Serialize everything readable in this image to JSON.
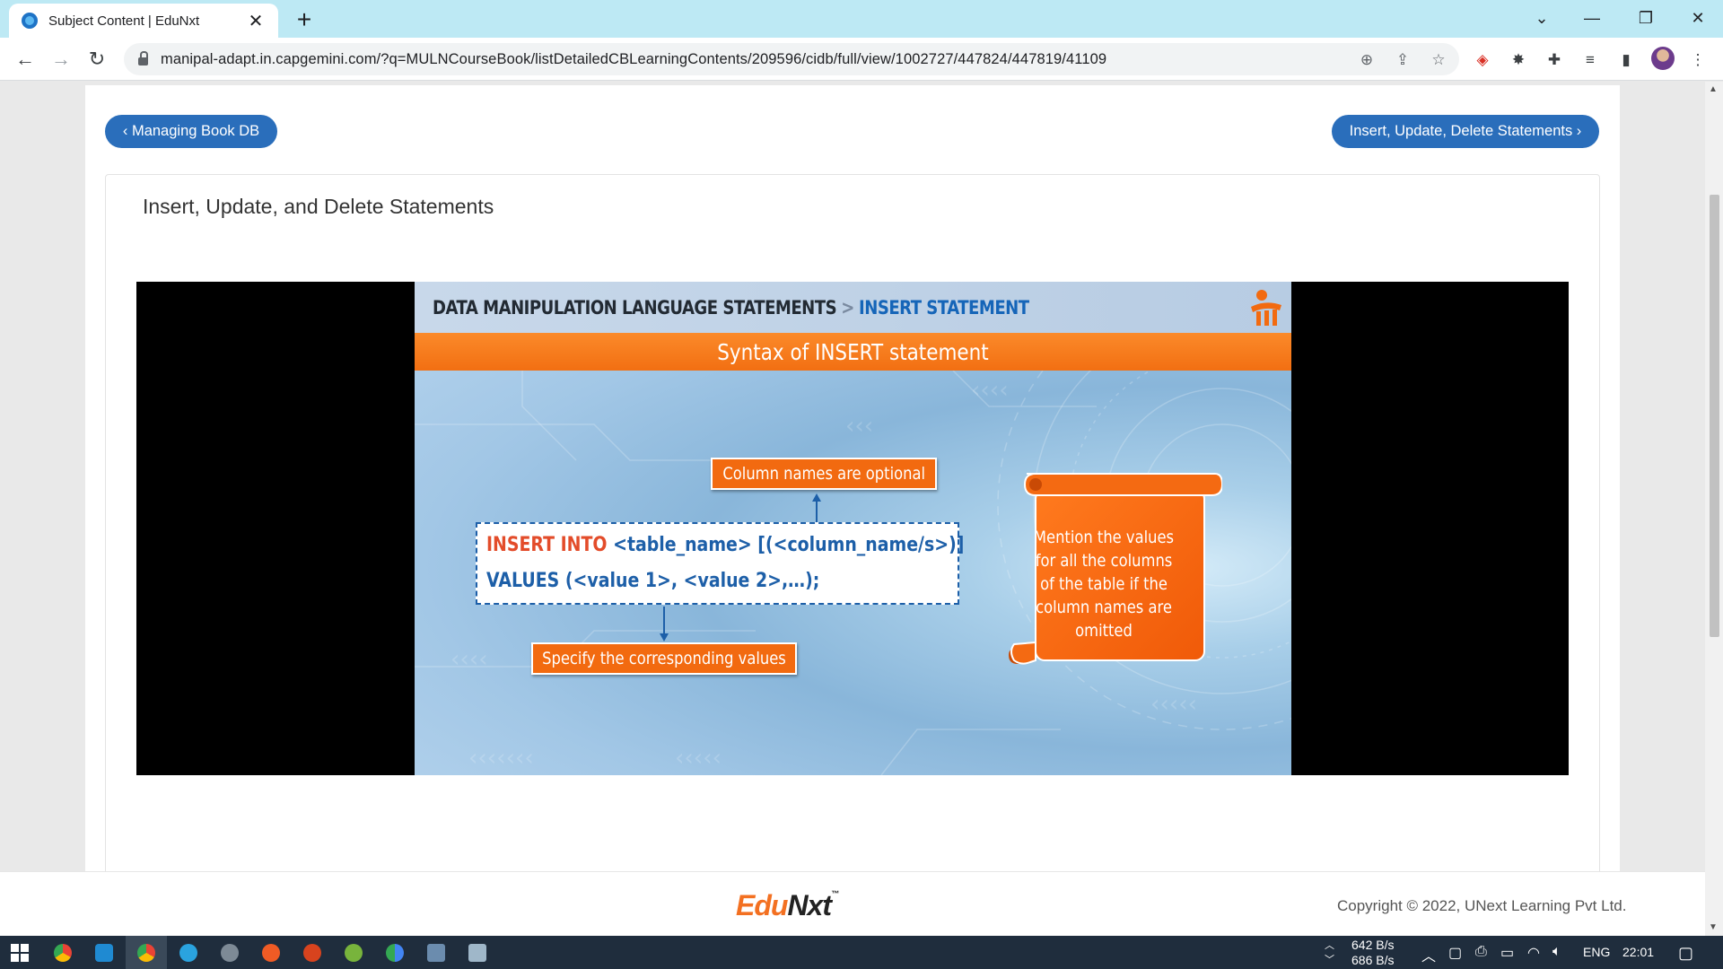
{
  "browser": {
    "tab_title": "Subject Content | EduNxt",
    "url": "manipal-adapt.in.capgemini.com/?q=MULNCourseBook/listDetailedCBLearningContents/209596/cidb/full/view/1002727/447824/447819/41109"
  },
  "nav": {
    "prev_label": "‹ Managing Book DB",
    "next_label": "Insert, Update, Delete Statements ›"
  },
  "lesson": {
    "title": "Insert, Update, and Delete Statements"
  },
  "slide": {
    "header_main": "DATA MANIPULATION LANGUAGE STATEMENTS",
    "header_sep": ">",
    "header_sub": "INSERT STATEMENT",
    "banner": "Syntax of INSERT statement",
    "callout_top": "Column names are optional",
    "syntax_kw1": "INSERT INTO",
    "syntax_rest1": " <table_name> [(<column_name/s>)]",
    "syntax_line2": "VALUES (<value 1>, <value 2>,…);",
    "callout_bottom": "Specify the corresponding values",
    "scroll_text": "Mention the values for all the columns of the table if the column names are omitted"
  },
  "footer": {
    "logo_edu": "Edu",
    "logo_nxt": "Nxt",
    "logo_tm": "™",
    "copyright": "Copyright © 2022, UNext Learning Pvt Ltd."
  },
  "taskbar": {
    "net_up": "642 B/s",
    "net_down": "686 B/s",
    "lang": "ENG",
    "time": "22:01"
  },
  "colors": {
    "accent_blue": "#2a6ebb",
    "slide_orange": "#f26a10",
    "syntax_blue": "#1d5fa8",
    "syntax_red": "#e34c2a"
  }
}
